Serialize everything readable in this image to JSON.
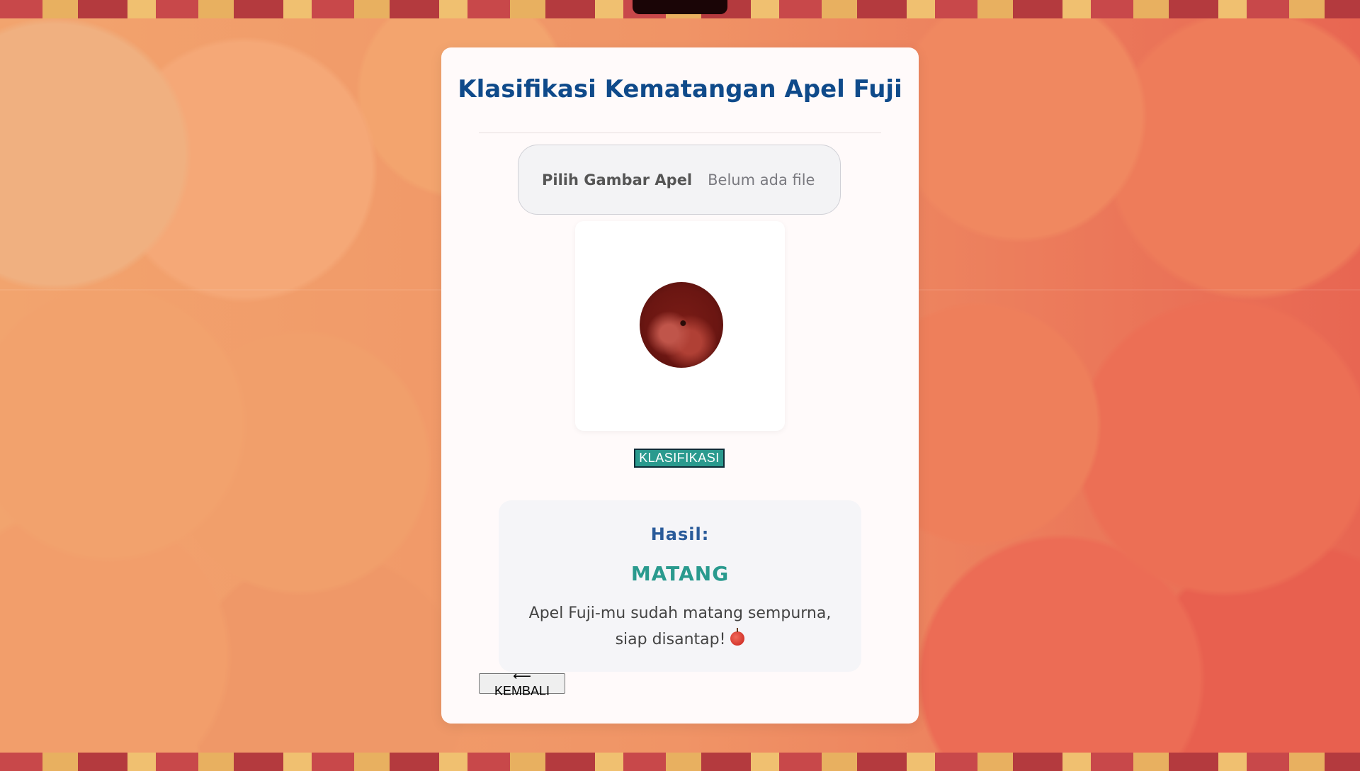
{
  "title": "Klasifikasi Kematangan Apel Fuji",
  "file_input": {
    "button_label": "Pilih Gambar Apel",
    "status": "Belum ada file"
  },
  "preview": {
    "image_name": "apple-preview-image"
  },
  "classify_button": "KLASIFIKASI",
  "result": {
    "label": "Hasil:",
    "value": "MATANG",
    "description": "Apel Fuji-mu sudah matang sempurna, siap disantap!",
    "emoji_icon": "red-apple-icon"
  },
  "back_button": "⟵ KEMBALI",
  "colors": {
    "title": "#0f4a8a",
    "accent": "#2a9a8e",
    "result_label": "#2a5b9a"
  }
}
